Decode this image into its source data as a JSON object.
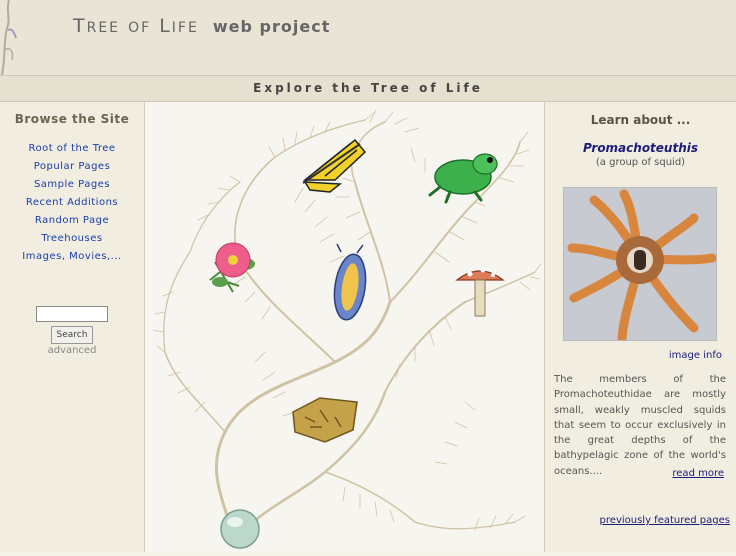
{
  "header": {
    "title_T": "T",
    "title_REE": "REE",
    "title_OF": "OF",
    "title_L": "L",
    "title_IFE": "IFE",
    "title_rest": "web project"
  },
  "banner": {
    "text": "Explore the Tree of Life"
  },
  "left": {
    "heading": "Browse the Site",
    "nav": [
      "Root of the Tree",
      "Popular Pages",
      "Sample Pages",
      "Recent Additions",
      "Random Page",
      "Treehouses",
      "Images, Movies,..."
    ],
    "search_button": "Search",
    "advanced": "advanced"
  },
  "right": {
    "heading": "Learn about ...",
    "featured_name": "Promachoteuthis",
    "featured_sub": "(a group of squid)",
    "image_info": "image info",
    "description": "The members of the Promachoteuthidae are mostly small, weakly muscled squids that seem to occur exclusively in the great depths of the bathypelagic zone of the world's oceans....",
    "read_more": "read more",
    "previous": "previously featured pages"
  },
  "colors": {
    "link": "#1a3ea8",
    "header_bg": "#e9e4d6",
    "tree": "#c9bd9e"
  }
}
